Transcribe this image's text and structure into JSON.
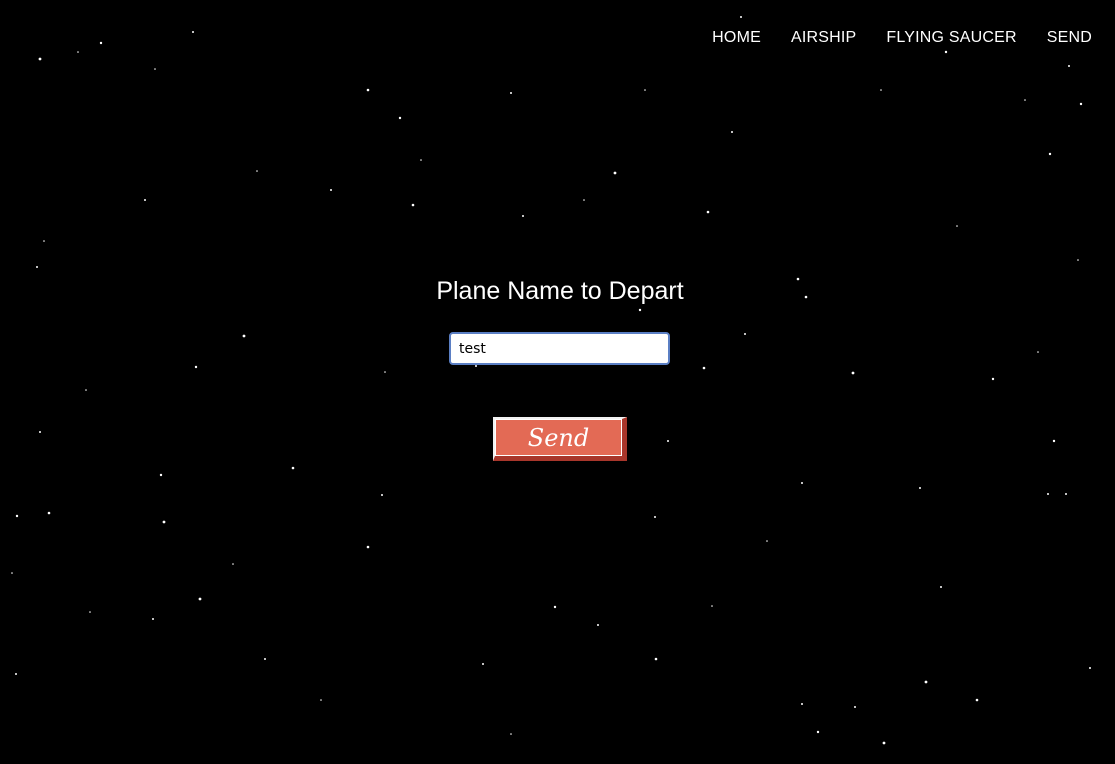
{
  "nav": {
    "items": [
      {
        "label": "HOME"
      },
      {
        "label": "AIRSHIP"
      },
      {
        "label": "FLYING SAUCER"
      },
      {
        "label": "SEND"
      }
    ]
  },
  "form": {
    "heading": "Plane Name to Depart",
    "input_value": "test",
    "submit_label": "Send"
  },
  "colors": {
    "background": "#000000",
    "button": "#e36a55",
    "button_shadow": "#a8362b",
    "input_border": "#5b7fc4"
  }
}
